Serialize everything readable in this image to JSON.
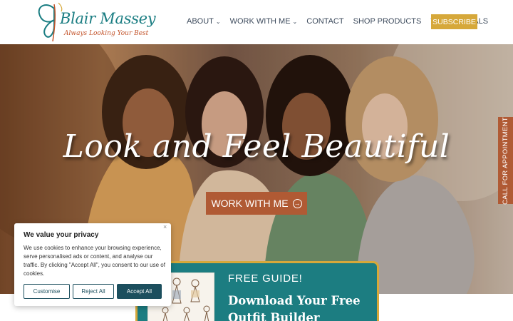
{
  "brand": {
    "name": "Blair Massey",
    "tagline": "Always Looking Your Best"
  },
  "nav": {
    "items": [
      {
        "label": "ABOUT",
        "dropdown": true
      },
      {
        "label": "WORK WITH ME",
        "dropdown": true
      },
      {
        "label": "CONTACT",
        "dropdown": false
      },
      {
        "label": "SHOP PRODUCTS",
        "dropdown": false
      },
      {
        "label": "TESTIMONIALS",
        "dropdown": false
      }
    ],
    "subscribe_label": "SUBSCRIBE"
  },
  "hero": {
    "headline": "Look and Feel Beautiful",
    "cta_label": "WORK WITH ME"
  },
  "side_tab": {
    "label": "CALL FOR APPOINTMENT"
  },
  "guide": {
    "kicker": "FREE GUIDE!",
    "title": "Download Your Free Outfit Builder"
  },
  "cookie": {
    "title": "We value your privacy",
    "text": "We use cookies to enhance your browsing experience, serve personalised ads or content, and analyse our traffic. By clicking \"Accept All\", you consent to our use of cookies.",
    "customise_label": "Customise",
    "reject_label": "Reject All",
    "accept_label": "Accept All",
    "close_label": "×"
  },
  "colors": {
    "brand_teal": "#1c7d81",
    "accent_gold": "#d6a83a",
    "accent_rust": "#b05a34",
    "cookie_button": "#1c4f5e"
  }
}
